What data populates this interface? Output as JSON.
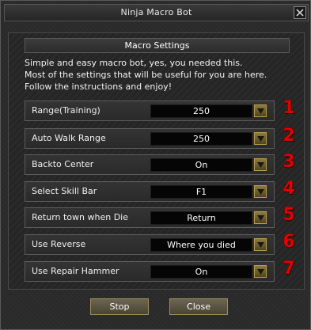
{
  "window": {
    "title": "Ninja Macro Bot"
  },
  "panel": {
    "header": "Macro Settings",
    "description": [
      "Simple and easy macro bot, yes, you needed this.",
      "Most of the settings that will be useful for you are here.",
      "Follow the instructions and enjoy!"
    ]
  },
  "settings": [
    {
      "label": "Range(Training)",
      "value": "250",
      "number": "1"
    },
    {
      "label": "Auto Walk Range",
      "value": "250",
      "number": "2"
    },
    {
      "label": "Backto Center",
      "value": "On",
      "number": "3"
    },
    {
      "label": "Select Skill Bar",
      "value": "F1",
      "number": "4"
    },
    {
      "label": "Return town when Die",
      "value": "Return",
      "number": "5"
    },
    {
      "label": "Use Reverse",
      "value": "Where you died",
      "number": "6"
    },
    {
      "label": "Use Repair Hammer",
      "value": "On",
      "number": "7"
    }
  ],
  "buttons": {
    "stop": "Stop",
    "close": "Close"
  },
  "icons": {
    "close": "close-icon",
    "dropdown": "chevron-down-icon"
  },
  "colors": {
    "annotation_number": "#e00000",
    "button_border": "#a08c5a"
  }
}
